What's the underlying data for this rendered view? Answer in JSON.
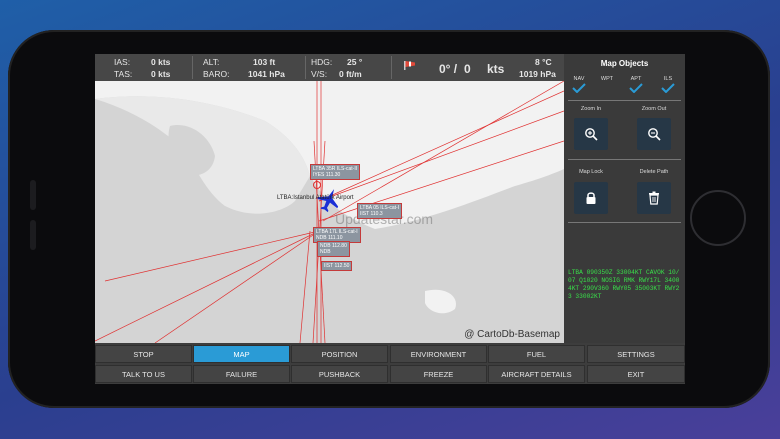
{
  "topbar": {
    "ias_label": "IAS:",
    "ias_value": "0 kts",
    "tas_label": "TAS:",
    "tas_value": "0 kts",
    "alt_label": "ALT:",
    "alt_value": "103 ft",
    "baro_label": "BARO:",
    "baro_value": "1041 hPa",
    "hdg_label": "HDG:",
    "hdg_value": "25 °",
    "vs_label": "V/S:",
    "vs_value": "0 ft/m",
    "wind_dir": "0° /",
    "wind_speed": "0",
    "wind_unit": "kts",
    "temp_value": "8 °C",
    "pressure_value": "1019 hPa"
  },
  "map": {
    "airport_label": "LTBA:Istanbul Atatürk Airport",
    "attribution": "@ CartoDb-Basemap",
    "watermark": "Updatestar.com",
    "ils_labels": [
      {
        "l1": "LTBA 35R ILS-cat-II",
        "l2": "IYES 111.30"
      },
      {
        "l1": "LTBA 05 ILS-cat-I",
        "l2": "IIST 110.3"
      },
      {
        "l1": "LTBA 17L ILS-cat-I",
        "l2": "NDB 111.10"
      },
      {
        "l1": "NDB 112.80",
        "l2": "NDB"
      },
      {
        "l1": "IIST 112.50",
        "l2": ""
      }
    ]
  },
  "panel": {
    "title": "Map Objects",
    "objects": [
      {
        "label": "NAV",
        "checked": true
      },
      {
        "label": "WPT",
        "checked": false
      },
      {
        "label": "APT",
        "checked": true
      },
      {
        "label": "ILS",
        "checked": true
      }
    ],
    "zoom_in": "Zoom In",
    "zoom_out": "Zoom Out",
    "map_lock": "Map Lock",
    "delete_path": "Delete Path",
    "metar": "LTBA 090350Z 33004KT CAVOK 10/07 Q1020 NOSIG RMK RWY17L 34004KT 290V360 RWY05 35003KT RWY23 33002KT"
  },
  "buttons": {
    "row1": [
      "STOP",
      "MAP",
      "POSITION",
      "ENVIRONMENT",
      "FUEL",
      "SETTINGS"
    ],
    "row2": [
      "TALK TO US",
      "FAILURE",
      "PUSHBACK",
      "FREEZE",
      "AIRCRAFT DETAILS",
      "EXIT"
    ]
  },
  "colors": {
    "accent": "#2a9bd6",
    "metar_text": "#39e04a",
    "ils_lines": "#e03030",
    "plane": "#1b2fd6"
  }
}
